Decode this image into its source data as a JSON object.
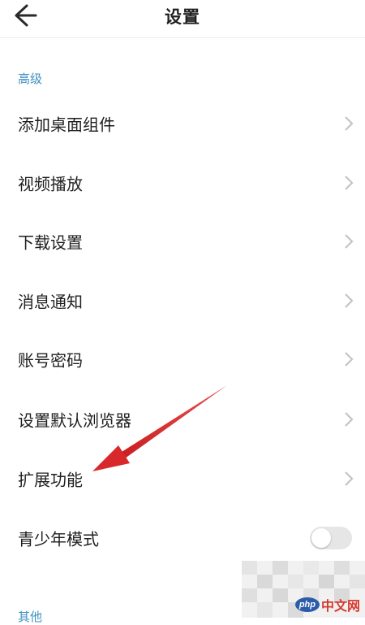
{
  "header": {
    "title": "设置",
    "back_icon": "back-arrow-icon"
  },
  "sections": {
    "advanced_label": "高级",
    "other_label": "其他"
  },
  "settings": {
    "items": [
      {
        "label": "添加桌面组件",
        "control": "chevron"
      },
      {
        "label": "视频播放",
        "control": "chevron"
      },
      {
        "label": "下载设置",
        "control": "chevron"
      },
      {
        "label": "消息通知",
        "control": "chevron"
      },
      {
        "label": "账号密码",
        "control": "chevron"
      },
      {
        "label": "设置默认浏览器",
        "control": "chevron"
      },
      {
        "label": "扩展功能",
        "control": "chevron"
      },
      {
        "label": "青少年模式",
        "control": "toggle",
        "enabled": false
      }
    ]
  },
  "colors": {
    "section_label": "#3f8fc2",
    "text": "#1f1f1f",
    "chevron": "#c4c4c4",
    "annotation_arrow": "#d8282b",
    "toggle_off": "#e6e6e6"
  },
  "watermark": {
    "logo_badge": "php",
    "logo_text": "中文网"
  }
}
